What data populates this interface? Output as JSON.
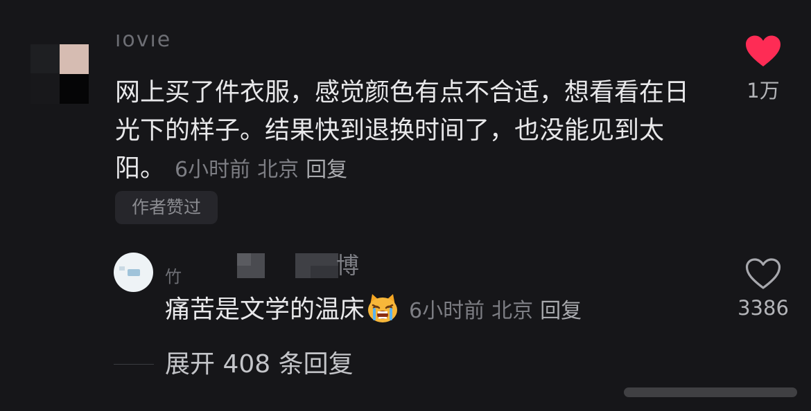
{
  "comment": {
    "username": "lovie",
    "text": "网上买了件衣服，感觉颜色有点不合适，想看看在日光下的样子。结果快到退换时间了，也没能见到太阳。",
    "time": "6小时前",
    "location": "北京",
    "reply_label": "回复",
    "author_liked_badge": "作者赞过",
    "like_count": "1万",
    "like_icon": "heart-filled-icon",
    "like_color": "#fe2c55"
  },
  "reply": {
    "username_fragment": "竹",
    "username_tail": "博",
    "text": "痛苦是文学的温床",
    "emoji": "crying-cat-emoji",
    "time": "6小时前",
    "location": "北京",
    "reply_label": "回复",
    "like_count": "3386",
    "like_icon": "heart-outline-icon"
  },
  "expand": {
    "label": "展开 408 条回复"
  }
}
